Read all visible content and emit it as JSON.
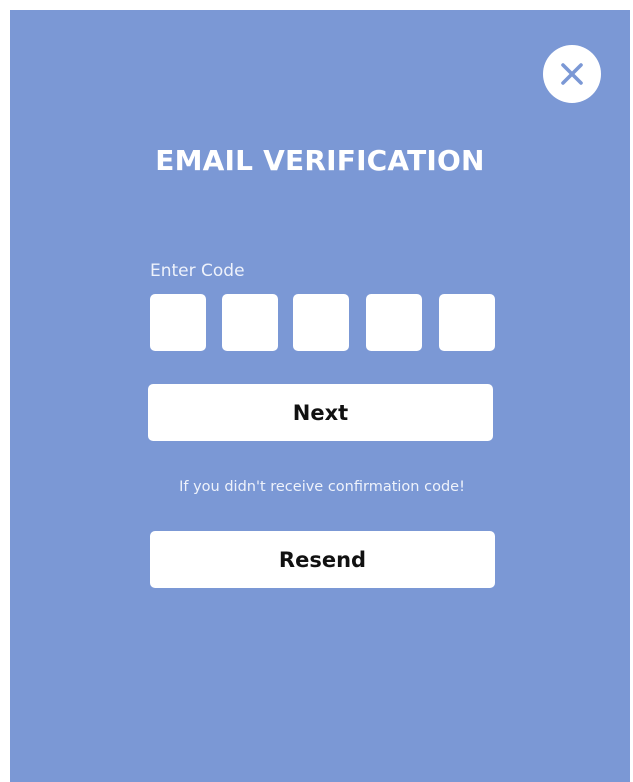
{
  "dialog": {
    "title": "EMAIL VERIFICATION",
    "close_icon": "close-icon",
    "code_label": "Enter Code",
    "code_digits": [
      "",
      "",
      "",
      "",
      ""
    ],
    "next_label": "Next",
    "hint_text": "If you didn't receive confirmation code!",
    "resend_label": "Resend"
  },
  "colors": {
    "background": "#7b98d5",
    "surface": "#ffffff",
    "close_icon": "#7b98d5",
    "button_text": "#111111"
  }
}
